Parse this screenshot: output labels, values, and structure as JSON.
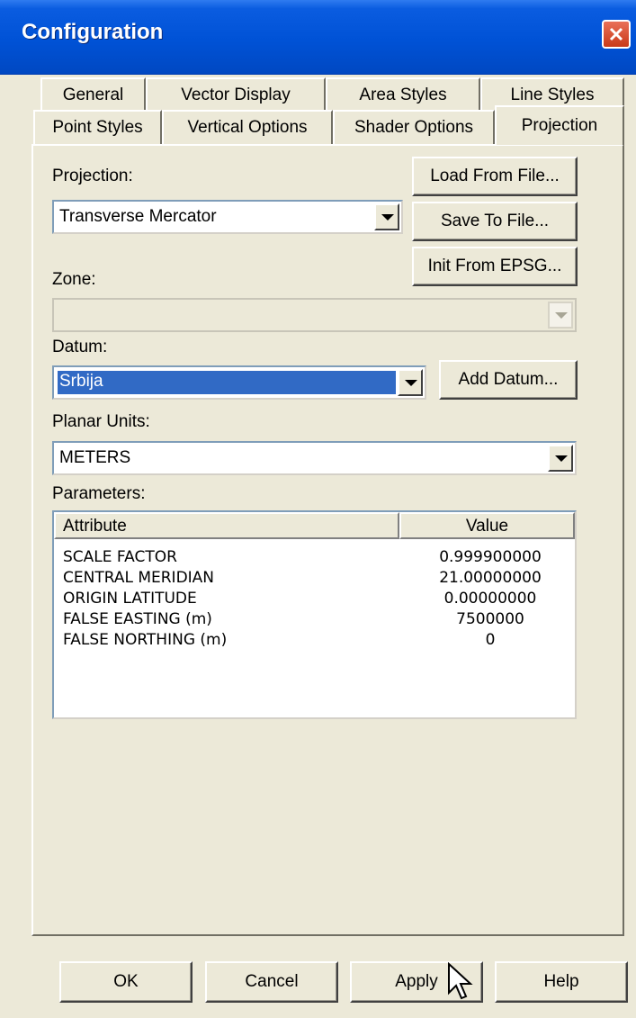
{
  "window": {
    "title": "Configuration"
  },
  "tabs": {
    "row_back": [
      "General",
      "Vector Display",
      "Area Styles",
      "Line Styles"
    ],
    "row_front": [
      "Point Styles",
      "Vertical Options",
      "Shader Options",
      "Projection"
    ],
    "active": "Projection"
  },
  "projection": {
    "label": "Projection:",
    "value": "Transverse Mercator",
    "load_button": "Load From File...",
    "save_button": "Save To File...",
    "init_button": "Init From EPSG..."
  },
  "zone": {
    "label": "Zone:",
    "value": ""
  },
  "datum": {
    "label": "Datum:",
    "value": "Srbija",
    "add_button": "Add Datum..."
  },
  "planar_units": {
    "label": "Planar Units:",
    "value": "METERS"
  },
  "parameters": {
    "label": "Parameters:",
    "columns": [
      "Attribute",
      "Value"
    ],
    "rows": [
      {
        "attribute": "SCALE FACTOR",
        "value": "0.999900000"
      },
      {
        "attribute": "CENTRAL MERIDIAN",
        "value": "21.00000000"
      },
      {
        "attribute": "ORIGIN LATITUDE",
        "value": "0.00000000"
      },
      {
        "attribute": "FALSE EASTING (m)",
        "value": "7500000"
      },
      {
        "attribute": "FALSE NORTHING (m)",
        "value": "0"
      }
    ]
  },
  "footer": {
    "ok": "OK",
    "cancel": "Cancel",
    "apply": "Apply",
    "help": "Help"
  },
  "icons": {
    "close": "close-icon",
    "dropdown": "chevron-down-icon",
    "cursor": "mouse-pointer-icon"
  },
  "colors": {
    "title_bar": "#0052d6",
    "selection": "#316ac5",
    "close_button": "#c93a18"
  }
}
